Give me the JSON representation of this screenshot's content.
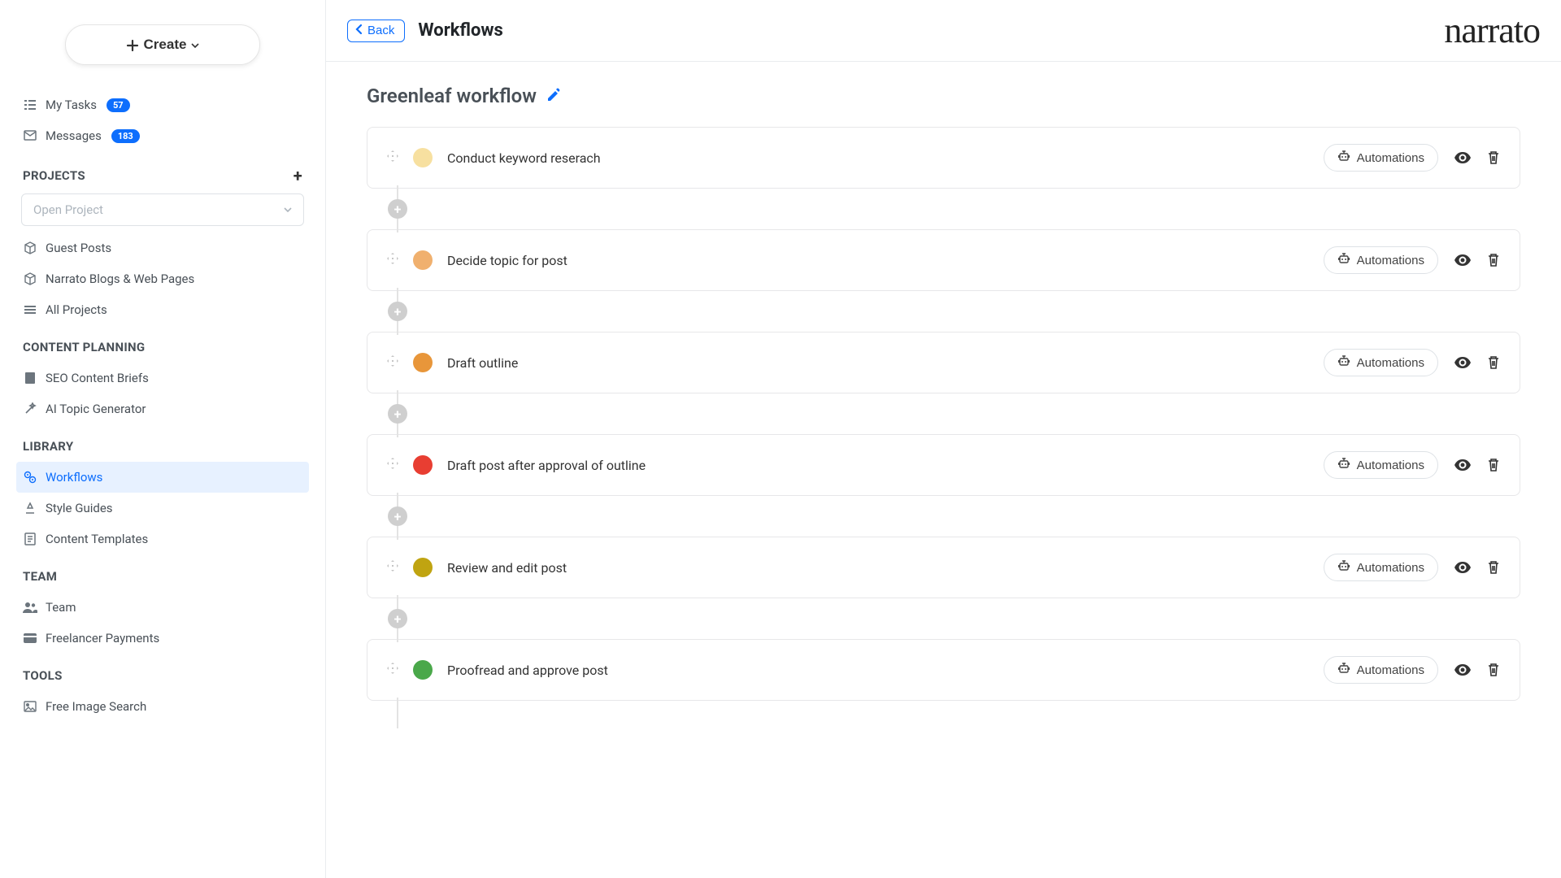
{
  "brand": "narrato",
  "sidebar": {
    "create_label": "Create",
    "my_tasks": {
      "label": "My Tasks",
      "count": "57"
    },
    "messages": {
      "label": "Messages",
      "count": "183"
    },
    "projects_header": "PROJECTS",
    "open_project_placeholder": "Open Project",
    "projects": [
      {
        "label": "Guest Posts"
      },
      {
        "label": "Narrato Blogs & Web Pages"
      },
      {
        "label": "All Projects"
      }
    ],
    "content_planning_header": "CONTENT PLANNING",
    "content_planning": [
      {
        "label": "SEO Content Briefs"
      },
      {
        "label": "AI Topic Generator"
      }
    ],
    "library_header": "LIBRARY",
    "library": [
      {
        "label": "Workflows"
      },
      {
        "label": "Style Guides"
      },
      {
        "label": "Content Templates"
      }
    ],
    "team_header": "TEAM",
    "team": [
      {
        "label": "Team"
      },
      {
        "label": "Freelancer Payments"
      }
    ],
    "tools_header": "TOOLS",
    "tools": [
      {
        "label": "Free Image Search"
      }
    ]
  },
  "header": {
    "back_label": "Back",
    "title": "Workflows"
  },
  "workflow": {
    "title": "Greenleaf workflow",
    "automations_label": "Automations",
    "steps": [
      {
        "name": "Conduct keyword reserach",
        "color": "#f7e0a0"
      },
      {
        "name": "Decide topic for post",
        "color": "#f0b06e"
      },
      {
        "name": "Draft outline",
        "color": "#e8963a"
      },
      {
        "name": "Draft post after approval of outline",
        "color": "#e83e32"
      },
      {
        "name": "Review and edit post",
        "color": "#c0a411"
      },
      {
        "name": "Proofread and approve post",
        "color": "#4aa84a"
      }
    ]
  }
}
